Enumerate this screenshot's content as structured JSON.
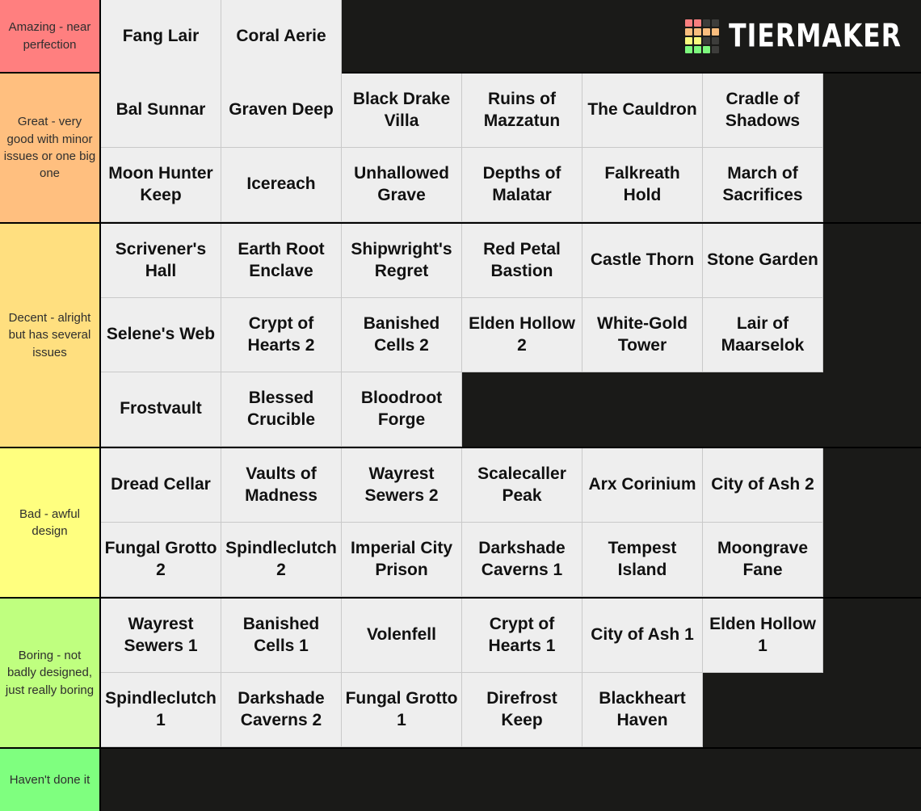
{
  "app": {
    "brand_name": "TIERMAKER",
    "logo_colors": [
      "#f97f7f",
      "#f97f7f",
      "#3d3d3b",
      "#3d3d3b",
      "#f9bd7e",
      "#f9bd7e",
      "#f9bd7e",
      "#f9bd7e",
      "#f9f97e",
      "#f9f97e",
      "#3d3d3b",
      "#3d3d3b",
      "#7ef97e",
      "#7ef97e",
      "#7ef97e",
      "#3d3d3b"
    ],
    "background": "#1a1a18"
  },
  "tiers": [
    {
      "id": "amazing",
      "label": "Amazing - near perfection",
      "color": "#ff7f7f",
      "rows": [
        [
          "Fang Lair",
          "Coral Aerie"
        ]
      ]
    },
    {
      "id": "great",
      "label": "Great - very good with minor issues or one big one",
      "color": "#ffbf7f",
      "rows": [
        [
          "Bal Sunnar",
          "Graven Deep",
          "Black Drake Villa",
          "Ruins of Mazzatun",
          "The Cauldron",
          "Cradle of Shadows"
        ],
        [
          "Moon Hunter Keep",
          "Icereach",
          "Unhallowed Grave",
          "Depths of Malatar",
          "Falkreath Hold",
          "March of Sacrifices"
        ]
      ]
    },
    {
      "id": "decent",
      "label": "Decent - alright but has several issues",
      "color": "#ffdf7f",
      "rows": [
        [
          "Scrivener's Hall",
          "Earth Root Enclave",
          "Shipwright's Regret",
          "Red Petal Bastion",
          "Castle Thorn",
          "Stone Garden"
        ],
        [
          "Selene's Web",
          "Crypt of Hearts 2",
          "Banished Cells 2",
          "Elden Hollow 2",
          "White-Gold Tower",
          "Lair of Maarselok"
        ],
        [
          "Frostvault",
          "Blessed Crucible",
          "Bloodroot Forge"
        ]
      ]
    },
    {
      "id": "bad",
      "label": "Bad - awful design",
      "color": "#ffff7f",
      "rows": [
        [
          "Dread Cellar",
          "Vaults of Madness",
          "Wayrest Sewers 2",
          "Scalecaller Peak",
          "Arx Corinium",
          "City of Ash 2"
        ],
        [
          "Fungal Grotto 2",
          "Spindleclutch 2",
          "Imperial City Prison",
          "Darkshade Caverns 1",
          "Tempest Island",
          "Moongrave Fane"
        ]
      ]
    },
    {
      "id": "boring",
      "label": "Boring - not badly designed, just really boring",
      "color": "#bfff7f",
      "rows": [
        [
          "Wayrest Sewers 1",
          "Banished Cells 1",
          "Volenfell",
          "Crypt of Hearts 1",
          "City of Ash 1",
          "Elden Hollow 1"
        ],
        [
          "Spindleclutch 1",
          "Darkshade Caverns 2",
          "Fungal Grotto 1",
          "Direfrost Keep",
          "Blackheart Haven"
        ]
      ]
    },
    {
      "id": "haven",
      "label": "Haven't done it",
      "color": "#7fff7f",
      "rows": []
    }
  ]
}
